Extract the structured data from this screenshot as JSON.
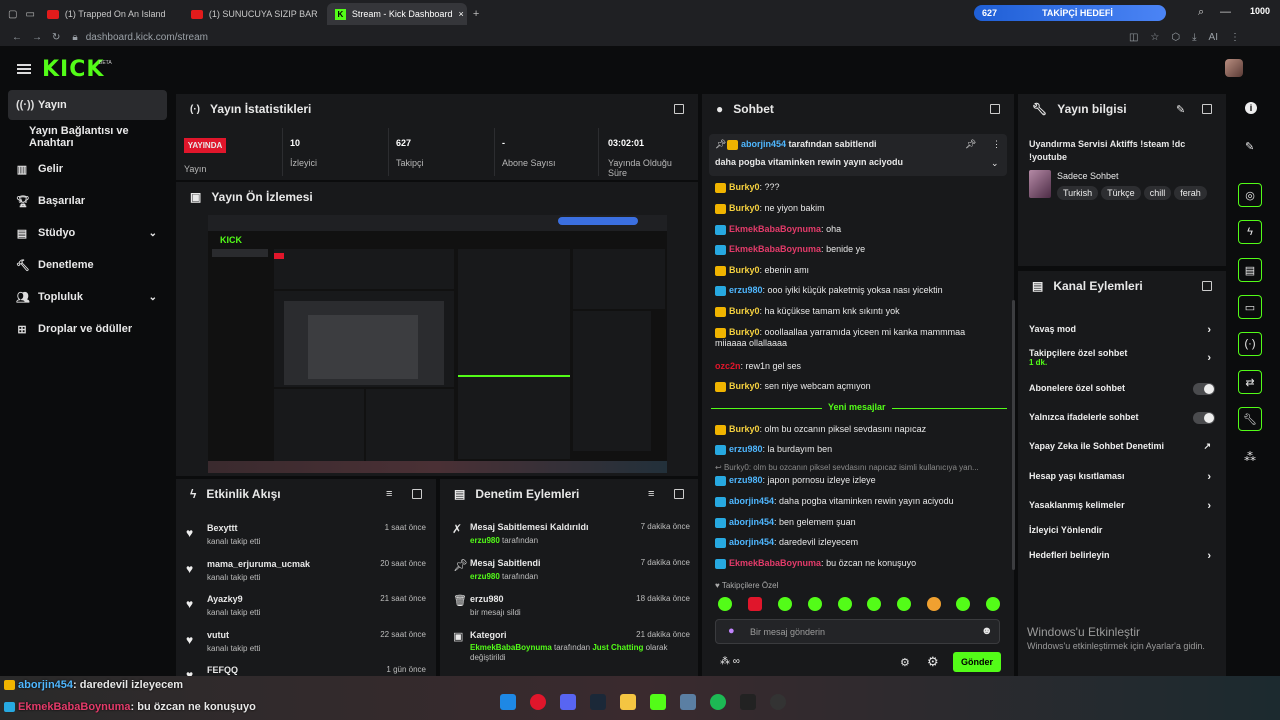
{
  "browser": {
    "tabs": [
      {
        "label": "(1) Trapped On An Island"
      },
      {
        "label": "(1) SUNUCUYA SIZIP BAR"
      },
      {
        "label": "Stream - Kick Dashboard"
      }
    ],
    "url": "dashboard.kick.com/stream",
    "ai": "AI"
  },
  "follow_goal": {
    "current": "627",
    "label": "TAKİPÇİ HEDEFİ",
    "target": "1000"
  },
  "brand": {
    "logo": "KICK",
    "beta": "BETA",
    "accent": "#53fc18"
  },
  "sidebar": {
    "items": [
      {
        "label": "Yayın",
        "icon": "live-icon"
      },
      {
        "label": "Yayın Bağlantısı ve Anahtarı",
        "icon": ""
      },
      {
        "label": "Gelir",
        "icon": "chart-icon"
      },
      {
        "label": "Başarılar",
        "icon": "trophy-icon"
      },
      {
        "label": "Stüdyo",
        "icon": "studio-icon"
      },
      {
        "label": "Denetleme",
        "icon": "hammer-icon"
      },
      {
        "label": "Topluluk",
        "icon": "community-icon"
      },
      {
        "label": "Droplar ve ödüller",
        "icon": "drops-icon"
      }
    ]
  },
  "stats": {
    "title": "Yayın İstatistikleri",
    "live_badge": "YAYINDA",
    "live_label": "Yayın",
    "items": [
      {
        "value": "10",
        "label": "İzleyici"
      },
      {
        "value": "627",
        "label": "Takipçi"
      },
      {
        "value": "-",
        "label": "Abone Sayısı"
      },
      {
        "value": "03:02:01",
        "label": "Yayında Olduğu Süre"
      }
    ]
  },
  "preview": {
    "title": "Yayın Ön İzlemesi"
  },
  "activity": {
    "title": "Etkinlik Akışı",
    "items": [
      {
        "name": "Bexyttt",
        "sub": "kanalı takip etti",
        "time": "1 saat önce"
      },
      {
        "name": "mama_erjuruma_ucmak",
        "sub": "kanalı takip etti",
        "time": "20 saat önce"
      },
      {
        "name": "Ayazky9",
        "sub": "kanalı takip etti",
        "time": "21 saat önce"
      },
      {
        "name": "vutut",
        "sub": "kanalı takip etti",
        "time": "22 saat önce"
      },
      {
        "name": "FEFQQ",
        "sub": "",
        "time": "1 gün önce"
      }
    ]
  },
  "moderation": {
    "title": "Denetim Eylemleri",
    "items": [
      {
        "title": "Mesaj Sabitlemesi Kaldırıldı",
        "user": "erzu980",
        "suffix": "tarafından",
        "time": "7 dakika önce"
      },
      {
        "title": "Mesaj Sabitlendi",
        "user": "erzu980",
        "suffix": "tarafından",
        "time": "7 dakika önce"
      },
      {
        "title": "erzu980",
        "user": "",
        "suffix": "bir mesajı sildi",
        "time": "18 dakika önce"
      },
      {
        "title": "Kategori",
        "user": "EkmekBabaBoynuma",
        "suffix": "tarafından",
        "extra": "Just Chatting",
        "extra2": "olarak değiştirildi",
        "time": "21 dakika önce"
      }
    ]
  },
  "chat": {
    "title": "Sohbet",
    "pinned": {
      "by": "aborjin454",
      "by_suffix": "tarafından sabitlendi",
      "message": "daha pogba vitaminken rewin yayın aciyodu"
    },
    "messages": [
      {
        "user": "Burky0",
        "text": "???",
        "style": "gold"
      },
      {
        "user": "Burky0",
        "text": "ne yiyon bakim",
        "style": "gold"
      },
      {
        "user": "EkmekBabaBoynuma",
        "text": "oha",
        "style": "pink"
      },
      {
        "user": "EkmekBabaBoynuma",
        "text": "benide ye",
        "style": "pink"
      },
      {
        "user": "Burky0",
        "text": "ebenin amı",
        "style": "gold"
      },
      {
        "user": "erzu980",
        "text": "ooo iyiki küçük paketmiş yoksa nası yicektin",
        "style": "blue"
      },
      {
        "user": "Burky0",
        "text": "ha küçükse tamam knk sıkıntı yok",
        "style": "gold"
      },
      {
        "user": "Burky0",
        "text": "ooollaallaa yarramıda yiceen mi kanka mammmaa",
        "text2": "miiaaaa ollallaaaa",
        "style": "gold"
      },
      {
        "user": "ozc2n",
        "text": "rew1n gel ses",
        "style": "red"
      },
      {
        "user": "Burky0",
        "text": "sen niye webcam açmıyon",
        "style": "gold"
      }
    ],
    "new_messages": "Yeni mesajlar",
    "messages2": [
      {
        "user": "Burky0",
        "text": "olm bu ozcanın piksel sevdasını napıcaz",
        "style": "gold"
      },
      {
        "user": "erzu980",
        "text": "la burdayım ben",
        "style": "blue"
      }
    ],
    "reply_preview": "Burky0: olm bu ozcanın piksel sevdasını napıcaz isimli kullanıcıya yan...",
    "messages3": [
      {
        "user": "erzu980",
        "text": "japon pornosu izleye izleye",
        "style": "blue"
      },
      {
        "user": "aborjin454",
        "text": "daha pogba vitaminken rewin yayın aciyodu",
        "style": "blue"
      },
      {
        "user": "aborjin454",
        "text": "ben gelemem şuan",
        "style": "blue"
      },
      {
        "user": "aborjin454",
        "text": "daredevil izleyecem",
        "style": "blue"
      },
      {
        "user": "EkmekBabaBoynuma",
        "text": "bu özcan ne konuşuyo",
        "style": "pink"
      }
    ],
    "follower_only": "Takipçilere Özel",
    "input_placeholder": "Bir mesaj gönderin",
    "send": "Gönder"
  },
  "stream_info": {
    "title": "Yayın bilgisi",
    "stream_title": "Uyandırma Servisi Aktiffs !steam !dc !youtube",
    "category": "Sadece Sohbet",
    "tags": [
      "Turkish",
      "Türkçe",
      "chill",
      "ferah"
    ]
  },
  "channel_actions": {
    "title": "Kanal Eylemleri",
    "items": [
      {
        "label": "Yavaş mod",
        "type": "arrow"
      },
      {
        "label": "Takipçilere özel sohbet",
        "sub": "1 dk.",
        "type": "arrow"
      },
      {
        "label": "Abonelere özel sohbet",
        "type": "toggle"
      },
      {
        "label": "Yalnızca ifadelerle sohbet",
        "type": "toggle"
      },
      {
        "label": "Yapay Zeka ile Sohbet Denetimi",
        "type": "external"
      },
      {
        "label": "Hesap yaşı kısıtlaması",
        "type": "arrow"
      },
      {
        "label": "Yasaklanmış kelimeler",
        "type": "arrow"
      },
      {
        "label": "İzleyici Yönlendir",
        "type": "none"
      },
      {
        "label": "Hedefleri belirleyin",
        "type": "arrow"
      }
    ]
  },
  "windows_watermark": {
    "title": "Windows'u Etkinleştir",
    "sub": "Windows'u etkinleştirmek için Ayarlar'a gidin."
  },
  "overlay_chat": [
    {
      "user": "aborjin454",
      "text": ": daredevil izleyecem"
    },
    {
      "user": "EkmekBabaBoynuma",
      "text": ": bu özcan ne konuşuyo"
    }
  ]
}
